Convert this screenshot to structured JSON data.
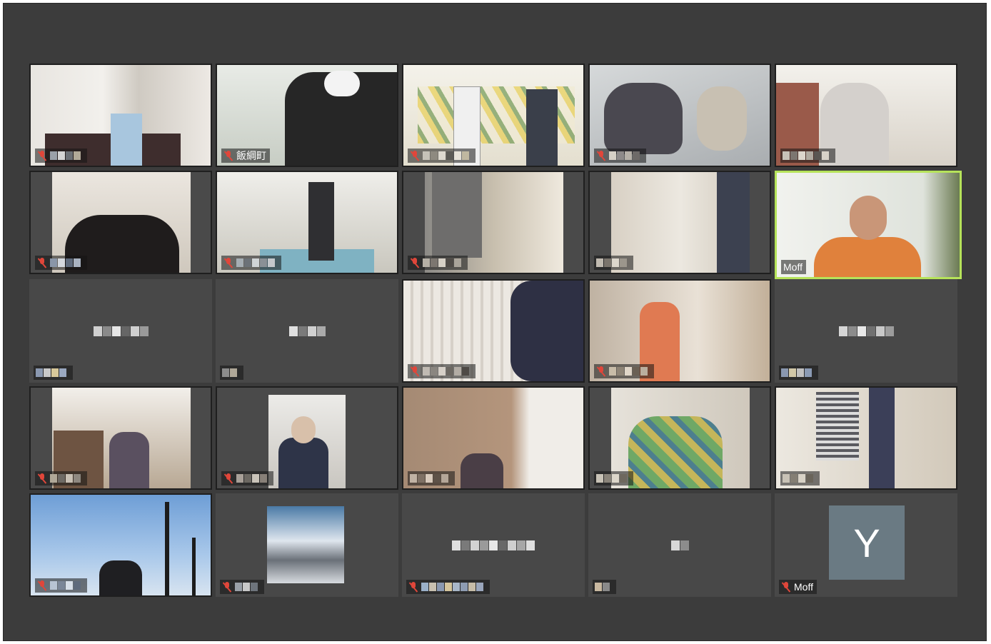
{
  "meeting": {
    "tiles": [
      {
        "name": "",
        "kind": "video"
      },
      {
        "name": "飯綱町",
        "kind": "video"
      },
      {
        "name": "",
        "kind": "video"
      },
      {
        "name": "",
        "kind": "video"
      },
      {
        "name": "",
        "kind": "video"
      },
      {
        "name": "",
        "kind": "video"
      },
      {
        "name": "",
        "kind": "video"
      },
      {
        "name": "",
        "kind": "video"
      },
      {
        "name": "",
        "kind": "video"
      },
      {
        "name": "Moff",
        "kind": "video-active"
      },
      {
        "name": "",
        "kind": "blank"
      },
      {
        "name": "",
        "kind": "blank"
      },
      {
        "name": "",
        "kind": "video"
      },
      {
        "name": "",
        "kind": "video"
      },
      {
        "name": "",
        "kind": "blank"
      },
      {
        "name": "",
        "kind": "video"
      },
      {
        "name": "",
        "kind": "video"
      },
      {
        "name": "",
        "kind": "video"
      },
      {
        "name": "",
        "kind": "video"
      },
      {
        "name": "",
        "kind": "video"
      },
      {
        "name": "",
        "kind": "video"
      },
      {
        "name": "",
        "kind": "video"
      },
      {
        "name": "",
        "kind": "blank"
      },
      {
        "name": "",
        "kind": "blank"
      },
      {
        "name": "Moff",
        "kind": "avatar",
        "avatar_letter": "Y"
      }
    ]
  },
  "colors": {
    "background": "#3c3c3c",
    "tile": "#4a4a4a",
    "active_speaker_border": "#b6e35a",
    "muted_mic": "#e0463a",
    "avatar": "#6a7a83"
  },
  "icons": [
    "microphone-muted-icon"
  ]
}
